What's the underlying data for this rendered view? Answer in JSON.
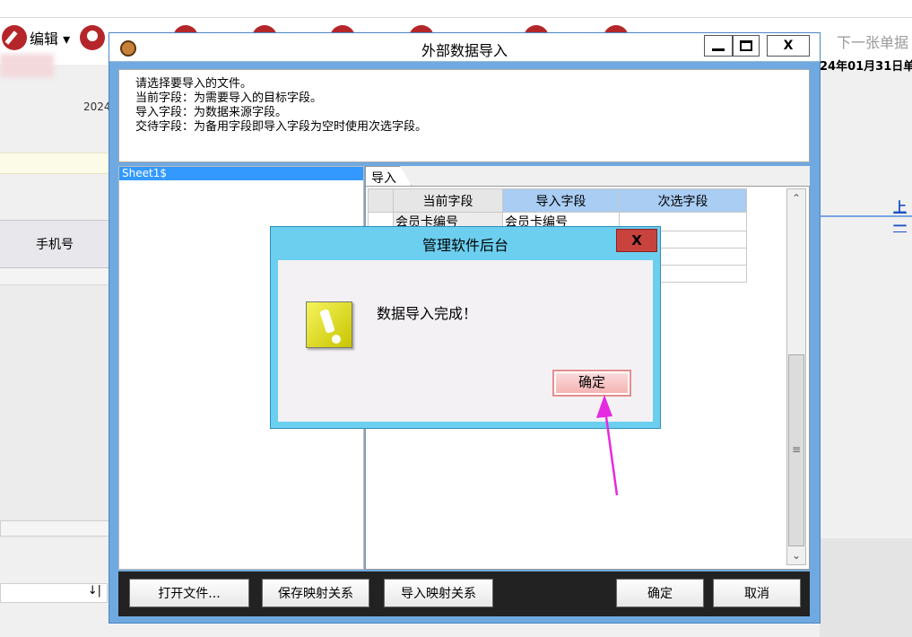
{
  "background": {
    "toolbar": {
      "edit_label": "编辑 ▾",
      "next_label": "下一张单据",
      "date_text": "24年01月31日单",
      "year_text": "2024"
    },
    "table_header": {
      "column1": "手机号"
    },
    "link_text": "上一",
    "bottom_field_suffix": "↓|"
  },
  "dialog": {
    "title": "外部数据导入",
    "controls": {
      "close": "X"
    },
    "info_lines": [
      "请选择要导入的文件。",
      "当前字段：为需要导入的目标字段。",
      "导入字段：为数据来源字段。",
      "交待字段：为备用字段即导入字段为空时使用次选字段。"
    ],
    "sheet_item": "Sheet1$",
    "tab_label": "导入",
    "grid": {
      "headers": [
        "当前字段",
        "导入字段",
        "次选字段"
      ],
      "rows": [
        [
          "会员卡编号",
          "会员卡编号",
          ""
        ]
      ]
    },
    "footer_buttons": {
      "open_file": "打开文件...",
      "save_mapping": "保存映射关系",
      "import_mapping": "导入映射关系",
      "ok": "确定",
      "cancel": "取消"
    }
  },
  "message_box": {
    "title": "管理软件后台",
    "close_label": "X",
    "message": "数据导入完成！",
    "ok_label": "确定",
    "icon": "warning-icon"
  },
  "colors": {
    "dialog_frame": "#6fa9df",
    "msgbox_frame": "#6ccff0",
    "selection": "#3399ff",
    "annotation_arrow": "#e52ae0",
    "toolbar_red": "#b5262a"
  }
}
